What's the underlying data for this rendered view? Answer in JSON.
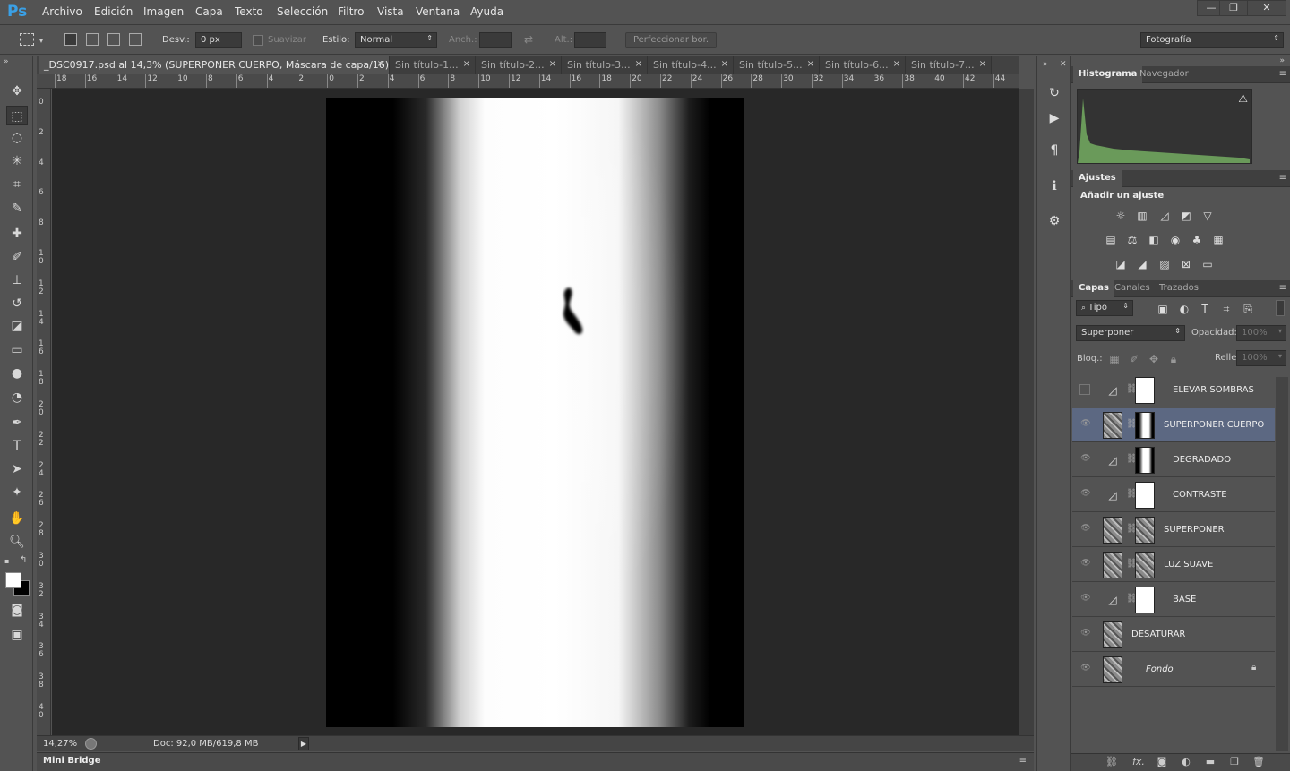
{
  "app": {
    "logo": "Ps"
  },
  "menu": [
    "Archivo",
    "Edición",
    "Imagen",
    "Capa",
    "Texto",
    "Selección",
    "Filtro",
    "Vista",
    "Ventana",
    "Ayuda"
  ],
  "window_controls": {
    "minimize": "—",
    "restore": "❐",
    "close": "✕"
  },
  "options": {
    "feather_label": "Desv.:",
    "feather_value": "0 px",
    "antialias_label": "Suavizar",
    "style_label": "Estilo:",
    "style_value": "Normal",
    "width_label": "Anch.:",
    "height_label": "Alt.:",
    "refine_button": "Perfeccionar bor.",
    "workspace": "Fotografía"
  },
  "tabs": [
    {
      "label": "_DSC0917.psd al 14,3% (SUPERPONER CUERPO, Máscara de capa/16) *",
      "close": "×"
    },
    {
      "label": "Sin título-1...",
      "close": "×"
    },
    {
      "label": "Sin título-2...",
      "close": "×"
    },
    {
      "label": "Sin título-3...",
      "close": "×"
    },
    {
      "label": "Sin título-4...",
      "close": "×"
    },
    {
      "label": "Sin título-5...",
      "close": "×"
    },
    {
      "label": "Sin título-6...",
      "close": "×"
    },
    {
      "label": "Sin título-7...",
      "close": "×"
    }
  ],
  "ruler_h": [
    "18",
    "16",
    "14",
    "12",
    "10",
    "8",
    "6",
    "4",
    "2",
    "0",
    "2",
    "4",
    "6",
    "8",
    "10",
    "12",
    "14",
    "16",
    "18",
    "20",
    "22",
    "24",
    "26",
    "28",
    "30",
    "32",
    "34",
    "36",
    "38",
    "40",
    "42",
    "44"
  ],
  "ruler_v": [
    "0",
    "2",
    "4",
    "6",
    "8",
    "10",
    "12",
    "14",
    "16",
    "18",
    "20",
    "22",
    "24",
    "26",
    "28",
    "30",
    "32",
    "34",
    "36",
    "38",
    "40"
  ],
  "status": {
    "zoom": "14,27%",
    "doc": "Doc: 92,0 MB/619,8 MB"
  },
  "minibridge": {
    "label": "Mini Bridge"
  },
  "histogram_panel": {
    "tab1": "Histograma",
    "tab2": "Navegador",
    "warning": "⚠"
  },
  "adjustments_panel": {
    "tab": "Ajustes",
    "title": "Añadir un ajuste"
  },
  "layers_panel": {
    "tabs": [
      "Capas",
      "Canales",
      "Trazados"
    ],
    "filter_label": "Tipo",
    "blend_mode": "Superponer",
    "opacity_label": "Opacidad:",
    "opacity_value": "100%",
    "lock_label": "Bloq.:",
    "fill_label": "Relleno:",
    "fill_value": "100%",
    "layers": [
      {
        "name": "ELEVAR SOMBRAS",
        "visible": false,
        "type": "adjustment",
        "mask": "white"
      },
      {
        "name": "SUPERPONER CUERPO",
        "visible": true,
        "type": "photo",
        "mask": "gradient",
        "selected": true
      },
      {
        "name": "DEGRADADO",
        "visible": true,
        "type": "adjustment",
        "mask": "gradient"
      },
      {
        "name": "CONTRASTE",
        "visible": true,
        "type": "adjustment",
        "mask": "white"
      },
      {
        "name": "SUPERPONER",
        "visible": true,
        "type": "photo",
        "mask": "photo"
      },
      {
        "name": "LUZ SUAVE",
        "visible": true,
        "type": "photo",
        "mask": "photo"
      },
      {
        "name": "BASE",
        "visible": true,
        "type": "adjustment",
        "mask": "white"
      },
      {
        "name": "DESATURAR",
        "visible": true,
        "type": "photo",
        "mask": "none"
      },
      {
        "name": "Fondo",
        "visible": true,
        "type": "photo",
        "mask": "none",
        "locked": true
      }
    ]
  }
}
